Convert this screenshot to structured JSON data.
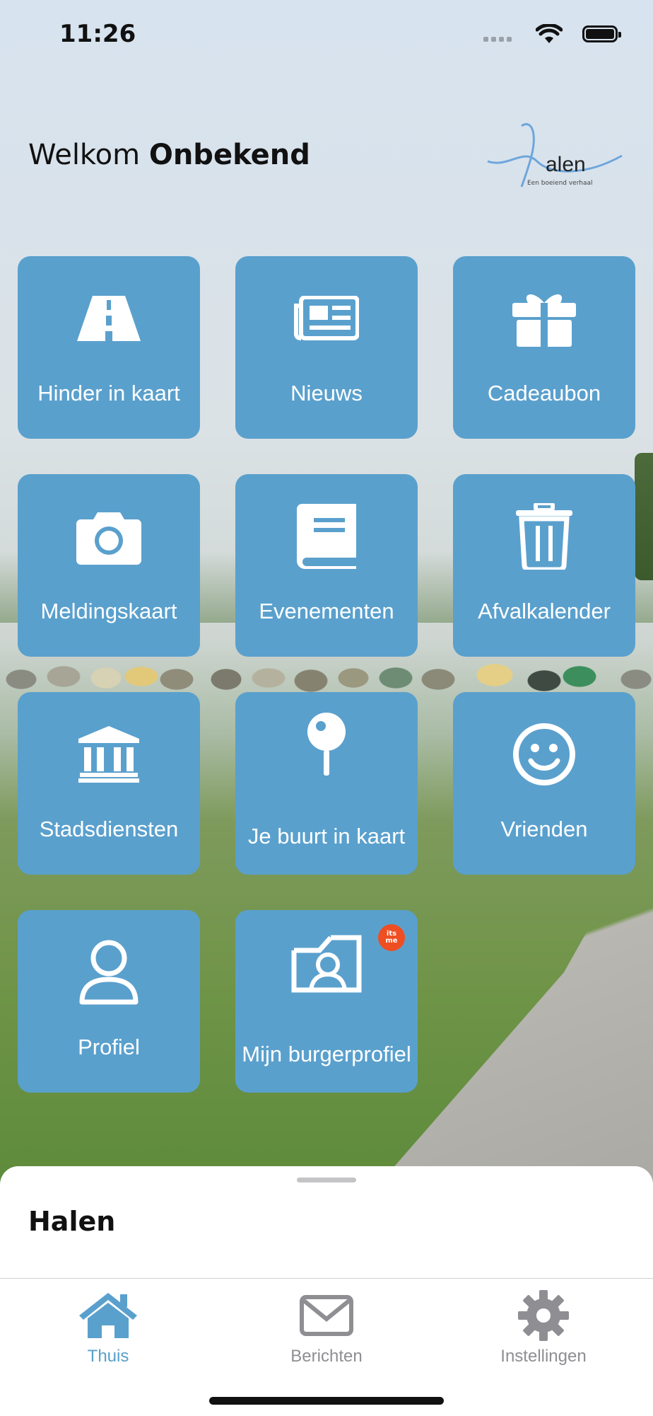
{
  "status_bar": {
    "time": "11:26"
  },
  "header": {
    "welcome_prefix": "Welkom",
    "user_name": "Onbekend"
  },
  "logo": {
    "text": "alen",
    "tagline": "Een boeiend verhaal"
  },
  "tiles": [
    {
      "label": "Hinder in kaart",
      "icon": "road-icon"
    },
    {
      "label": "Nieuws",
      "icon": "newspaper-icon"
    },
    {
      "label": "Cadeaubon",
      "icon": "gift-icon"
    },
    {
      "label": "Meldingskaart",
      "icon": "camera-icon"
    },
    {
      "label": "Evenementen",
      "icon": "book-icon"
    },
    {
      "label": "Afvalkalender",
      "icon": "trash-icon"
    },
    {
      "label": "Stadsdiensten",
      "icon": "city-hall-icon"
    },
    {
      "label": "Je buurt in kaart",
      "icon": "map-pin-icon"
    },
    {
      "label": "Vrienden",
      "icon": "smiley-icon"
    },
    {
      "label": "Profiel",
      "icon": "user-icon"
    },
    {
      "label": "Mijn burgerprofiel",
      "icon": "id-card-icon",
      "badge": {
        "line1": "its",
        "line2": "me"
      }
    }
  ],
  "sheet": {
    "title": "Halen"
  },
  "tabs": [
    {
      "label": "Thuis",
      "icon": "home-icon",
      "active": true
    },
    {
      "label": "Berichten",
      "icon": "envelope-icon",
      "active": false
    },
    {
      "label": "Instellingen",
      "icon": "gear-icon",
      "active": false
    }
  ],
  "colors": {
    "tile": "#5aa0cd",
    "tab_active": "#5aa0cd",
    "tab_inactive": "#8e8e93",
    "badge": "#ee4e22"
  }
}
